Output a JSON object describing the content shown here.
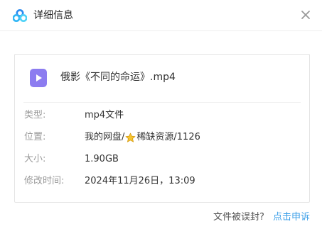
{
  "header": {
    "title": "详细信息",
    "logo_icon": "baidu-netdisk-logo-icon",
    "close_icon": "close-icon"
  },
  "file": {
    "icon": "video-file-icon",
    "icon_color": "#8c7cf0",
    "name": "俄影《不同的命运》.mp4"
  },
  "details": {
    "type_label": "类型:",
    "type_value": "mp4文件",
    "location_label": "位置:",
    "location_prefix": "我的网盘/",
    "location_icon": "star-icon",
    "location_suffix": "稀缺资源/1126",
    "size_label": "大小:",
    "size_value": "1.90GB",
    "modified_label": "修改时间:",
    "modified_value": "2024年11月26日，13:09"
  },
  "footer": {
    "question": "文件被误封?",
    "appeal_link": "点击申诉",
    "link_color": "#3a9ee8"
  }
}
